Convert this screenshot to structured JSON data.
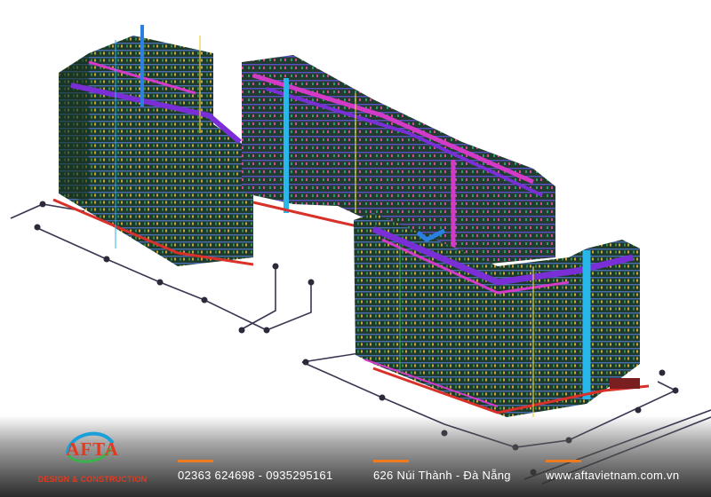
{
  "brand": {
    "name": "AFTA",
    "tagline": "DESIGN & CONSTRUCTION",
    "colors": {
      "primary": "#e23a1e",
      "accent": "#f07a1e",
      "swoosh_blue": "#1aa0d8",
      "swoosh_green": "#3bb24a"
    }
  },
  "contacts": {
    "phone": "02363 624698 - 0935295161",
    "address": "626 Núi Thành - Đà Nẵng",
    "website": "www.aftavietnam.com.vn"
  },
  "scene": {
    "description_icon": "mep-3d-model-icon",
    "colors": {
      "tower": "#1e3a2c",
      "pipe_purple": "#7a2fd6",
      "pipe_magenta": "#d43ac8",
      "pipe_red": "#d8312a",
      "pipe_blue": "#2a7fe0",
      "pipe_cyan": "#29b6e8",
      "yellow": "#e8d23a",
      "ground_line": "#3a3550"
    }
  }
}
